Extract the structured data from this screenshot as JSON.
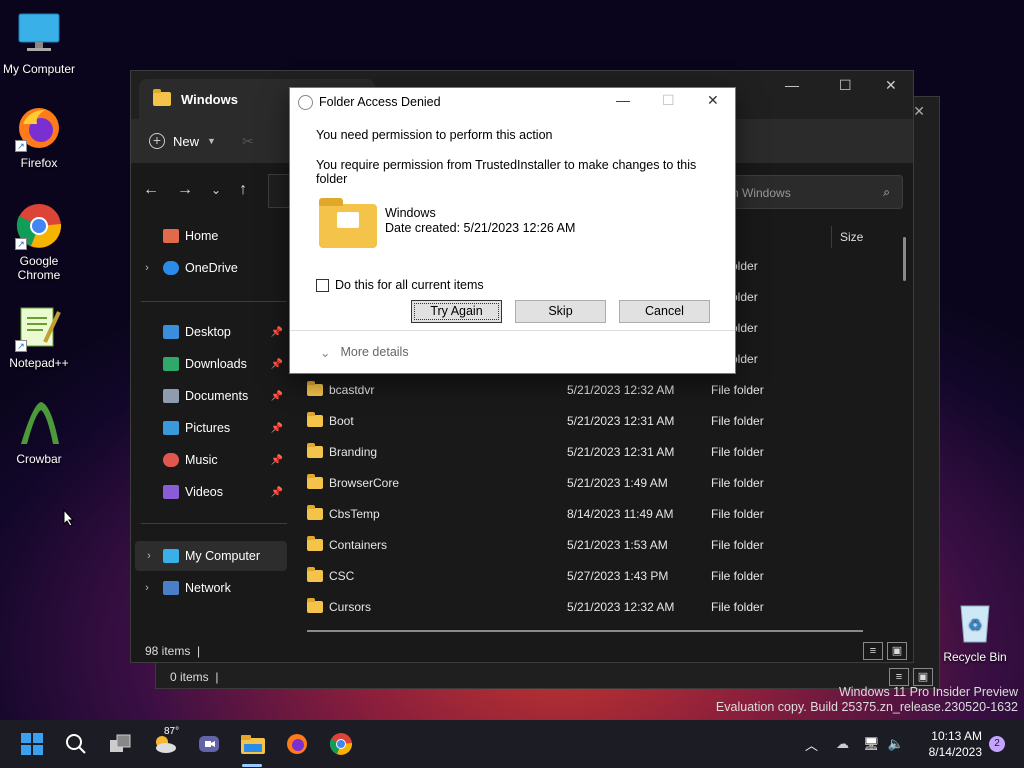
{
  "desktop": {
    "icons": [
      {
        "label": "My Computer"
      },
      {
        "label": "Firefox"
      },
      {
        "label": "Google Chrome"
      },
      {
        "label": "Notepad++"
      },
      {
        "label": "Crowbar"
      },
      {
        "label": "Recycle Bin"
      }
    ]
  },
  "explorer": {
    "tab_title": "Windows",
    "new_label": "New",
    "search_placeholder": "h Windows",
    "column_size": "Size",
    "sidebar": [
      {
        "label": "Home"
      },
      {
        "label": "OneDrive"
      },
      {
        "label": "Desktop"
      },
      {
        "label": "Downloads"
      },
      {
        "label": "Documents"
      },
      {
        "label": "Pictures"
      },
      {
        "label": "Music"
      },
      {
        "label": "Videos"
      },
      {
        "label": "My Computer"
      },
      {
        "label": "Network"
      }
    ],
    "rows": [
      {
        "type": "folder"
      },
      {
        "type": "folder"
      },
      {
        "type": "folder"
      },
      {
        "type": "folder"
      },
      {
        "name": "bcastdvr",
        "date": "5/21/2023 12:32 AM",
        "type": "File folder"
      },
      {
        "name": "Boot",
        "date": "5/21/2023 12:31 AM",
        "type": "File folder"
      },
      {
        "name": "Branding",
        "date": "5/21/2023 12:31 AM",
        "type": "File folder"
      },
      {
        "name": "BrowserCore",
        "date": "5/21/2023 1:49 AM",
        "type": "File folder"
      },
      {
        "name": "CbsTemp",
        "date": "8/14/2023 11:49 AM",
        "type": "File folder"
      },
      {
        "name": "Containers",
        "date": "5/21/2023 1:53 AM",
        "type": "File folder"
      },
      {
        "name": "CSC",
        "date": "5/27/2023 1:43 PM",
        "type": "File folder"
      },
      {
        "name": "Cursors",
        "date": "5/21/2023 12:32 AM",
        "type": "File folder"
      }
    ],
    "status": "98 items",
    "back_status": "0 items"
  },
  "dialog": {
    "title": "Folder Access Denied",
    "line1": "You need permission to perform this action",
    "line2": "You require permission from TrustedInstaller to make changes to this folder",
    "folder_name": "Windows",
    "folder_date": "Date created: 5/21/2023 12:26 AM",
    "checkbox_label": "Do this for all current items",
    "btn_try": "Try Again",
    "btn_skip": "Skip",
    "btn_cancel": "Cancel",
    "more_details": "More details"
  },
  "watermark": {
    "line1": "Windows 11 Pro Insider Preview",
    "line2": "Evaluation copy. Build 25375.zn_release.230520-1632"
  },
  "taskbar": {
    "weather_temp": "87°",
    "time": "10:13 AM",
    "date": "8/14/2023",
    "notification_count": "2"
  }
}
